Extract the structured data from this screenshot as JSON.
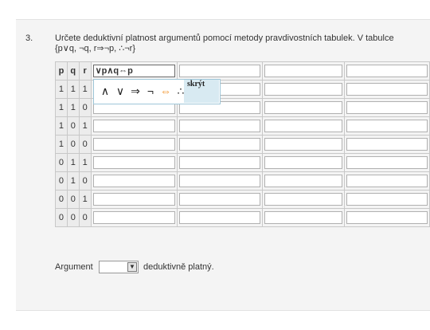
{
  "question": {
    "number": "3.",
    "text_line1": "Určete deduktivní platnost argumentů pomocí metody pravdivostních tabulek. V tabulce",
    "text_line2": "{p∨q, ¬q, r⇒¬p, ∴¬r}"
  },
  "table": {
    "headers": [
      "p",
      "q",
      "r"
    ],
    "rows": [
      [
        "1",
        "1",
        "1"
      ],
      [
        "1",
        "1",
        "0"
      ],
      [
        "1",
        "0",
        "1"
      ],
      [
        "1",
        "0",
        "0"
      ],
      [
        "0",
        "1",
        "1"
      ],
      [
        "0",
        "1",
        "0"
      ],
      [
        "0",
        "0",
        "1"
      ],
      [
        "0",
        "0",
        "0"
      ]
    ],
    "header_inputs": [
      "∨p∧q⇔p",
      "",
      "",
      ""
    ]
  },
  "symbol_popup": {
    "symbols": [
      "∧",
      "∨",
      "⇒",
      "¬",
      "⇔",
      "∴"
    ],
    "highlight_color": "#f08b1b",
    "hide_label": "skrýt"
  },
  "argument": {
    "label_before": "Argument",
    "selected": "",
    "label_after": "deduktivně platný."
  }
}
